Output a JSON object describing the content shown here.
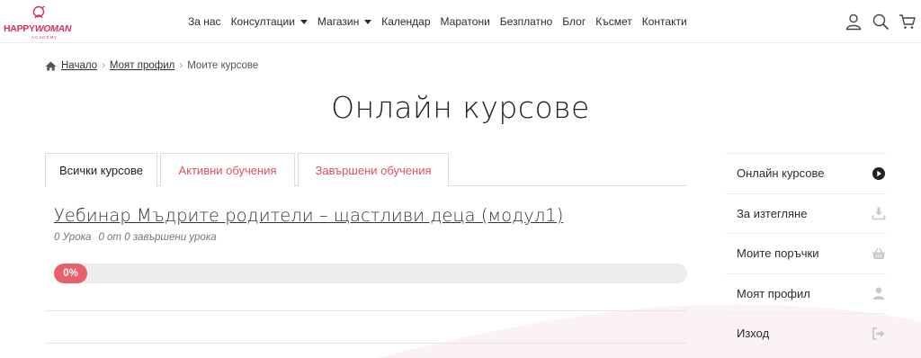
{
  "brand": {
    "logo_word1": "HAPPY",
    "logo_word2": "WOMAN",
    "logo_sub": "ACADEMY"
  },
  "nav": {
    "items": [
      {
        "label": "За нас",
        "dropdown": false
      },
      {
        "label": "Консултации",
        "dropdown": true
      },
      {
        "label": "Магазин",
        "dropdown": true
      },
      {
        "label": "Календар",
        "dropdown": false
      },
      {
        "label": "Маратони",
        "dropdown": false
      },
      {
        "label": "Безплатно",
        "dropdown": false
      },
      {
        "label": "Блог",
        "dropdown": false
      },
      {
        "label": "Късмет",
        "dropdown": false
      },
      {
        "label": "Контакти",
        "dropdown": false
      }
    ],
    "icons": [
      "user-icon",
      "search-icon",
      "cart-icon"
    ]
  },
  "breadcrumb": {
    "home": "Начало",
    "profile": "Моят профил",
    "current": "Моите курсове",
    "separator": "›"
  },
  "page": {
    "title": "Онлайн курсове"
  },
  "tabs": [
    {
      "label": "Всички курсове",
      "active": true
    },
    {
      "label": "Активни обучения",
      "active": false
    },
    {
      "label": "Завършени обучения",
      "active": false
    }
  ],
  "course": {
    "title": "Уебинар Мъдрите родители – щастливи деца (модул1)",
    "lessons": "0 Урока",
    "completed": "0 от 0 завършени урока",
    "progress_label": "0%",
    "progress_percent": 0
  },
  "sidebar": {
    "items": [
      {
        "label": "Онлайн курсове",
        "icon": "play-circle-icon"
      },
      {
        "label": "За изтегляне",
        "icon": "download-icon"
      },
      {
        "label": "Моите поръчки",
        "icon": "basket-icon"
      },
      {
        "label": "Моят профил",
        "icon": "user-icon"
      },
      {
        "label": "Изход",
        "icon": "sign-out-icon"
      }
    ]
  },
  "colors": {
    "accent": "#e0505d",
    "progress_fill": "#e8606a",
    "progress_track": "#ececec",
    "brand": "#d6335a"
  }
}
